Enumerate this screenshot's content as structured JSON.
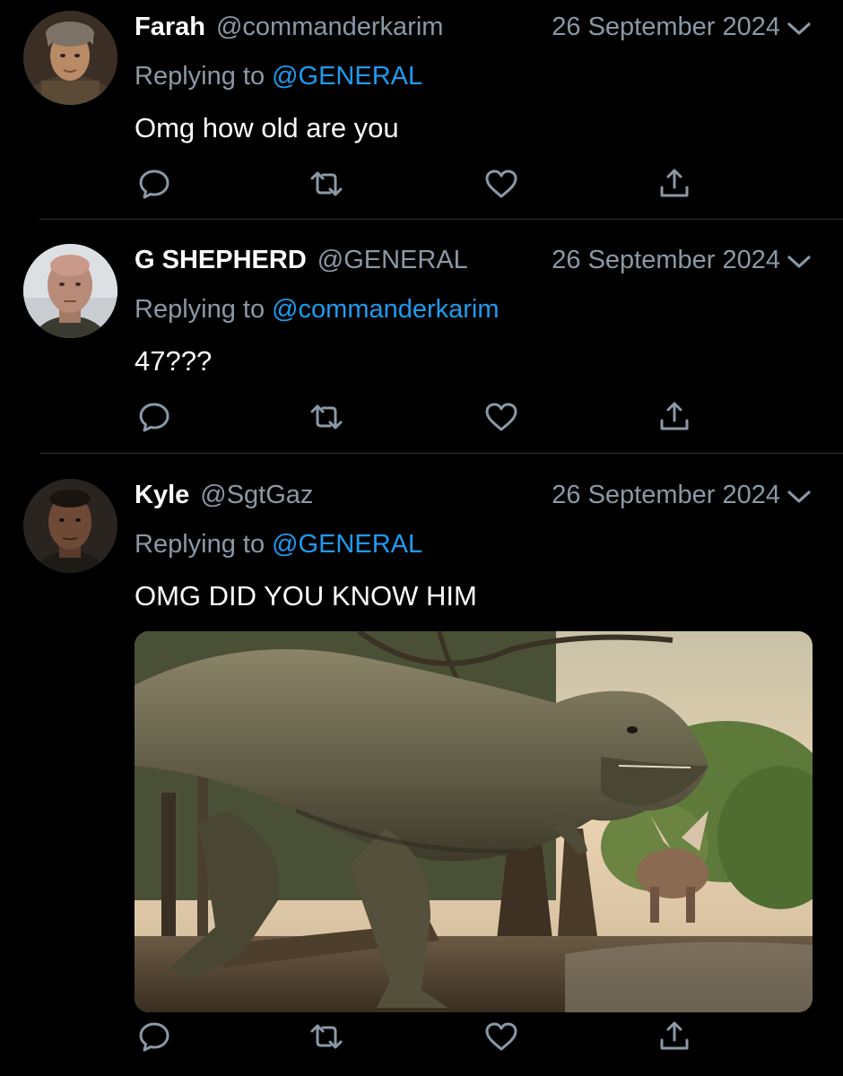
{
  "colors": {
    "background": "#000000",
    "text_primary": "#ffffff",
    "text_secondary": "#8b98a5",
    "link": "#1d9bf0",
    "divider": "#2f3336"
  },
  "tweets": [
    {
      "display_name": "Farah",
      "handle": "@commanderkarim",
      "date": "26 September 2024",
      "replying_prefix": "Replying to",
      "replying_to": "@GENERAL",
      "text": "Omg how old are you",
      "icons": [
        "reply-icon",
        "retweet-icon",
        "like-icon",
        "share-icon"
      ]
    },
    {
      "display_name": "G SHEPHERD",
      "handle": "@GENERAL",
      "date": "26 September 2024",
      "replying_prefix": "Replying to",
      "replying_to": "@commanderkarim",
      "text": "47???",
      "icons": [
        "reply-icon",
        "retweet-icon",
        "like-icon",
        "share-icon"
      ]
    },
    {
      "display_name": "Kyle",
      "handle": "@SgtGaz",
      "date": "26 September 2024",
      "replying_prefix": "Replying to",
      "replying_to": "@GENERAL",
      "text": "OMG DID YOU KNOW HIM",
      "media": "dinosaur-illustration",
      "icons": [
        "reply-icon",
        "retweet-icon",
        "like-icon",
        "share-icon"
      ]
    }
  ]
}
